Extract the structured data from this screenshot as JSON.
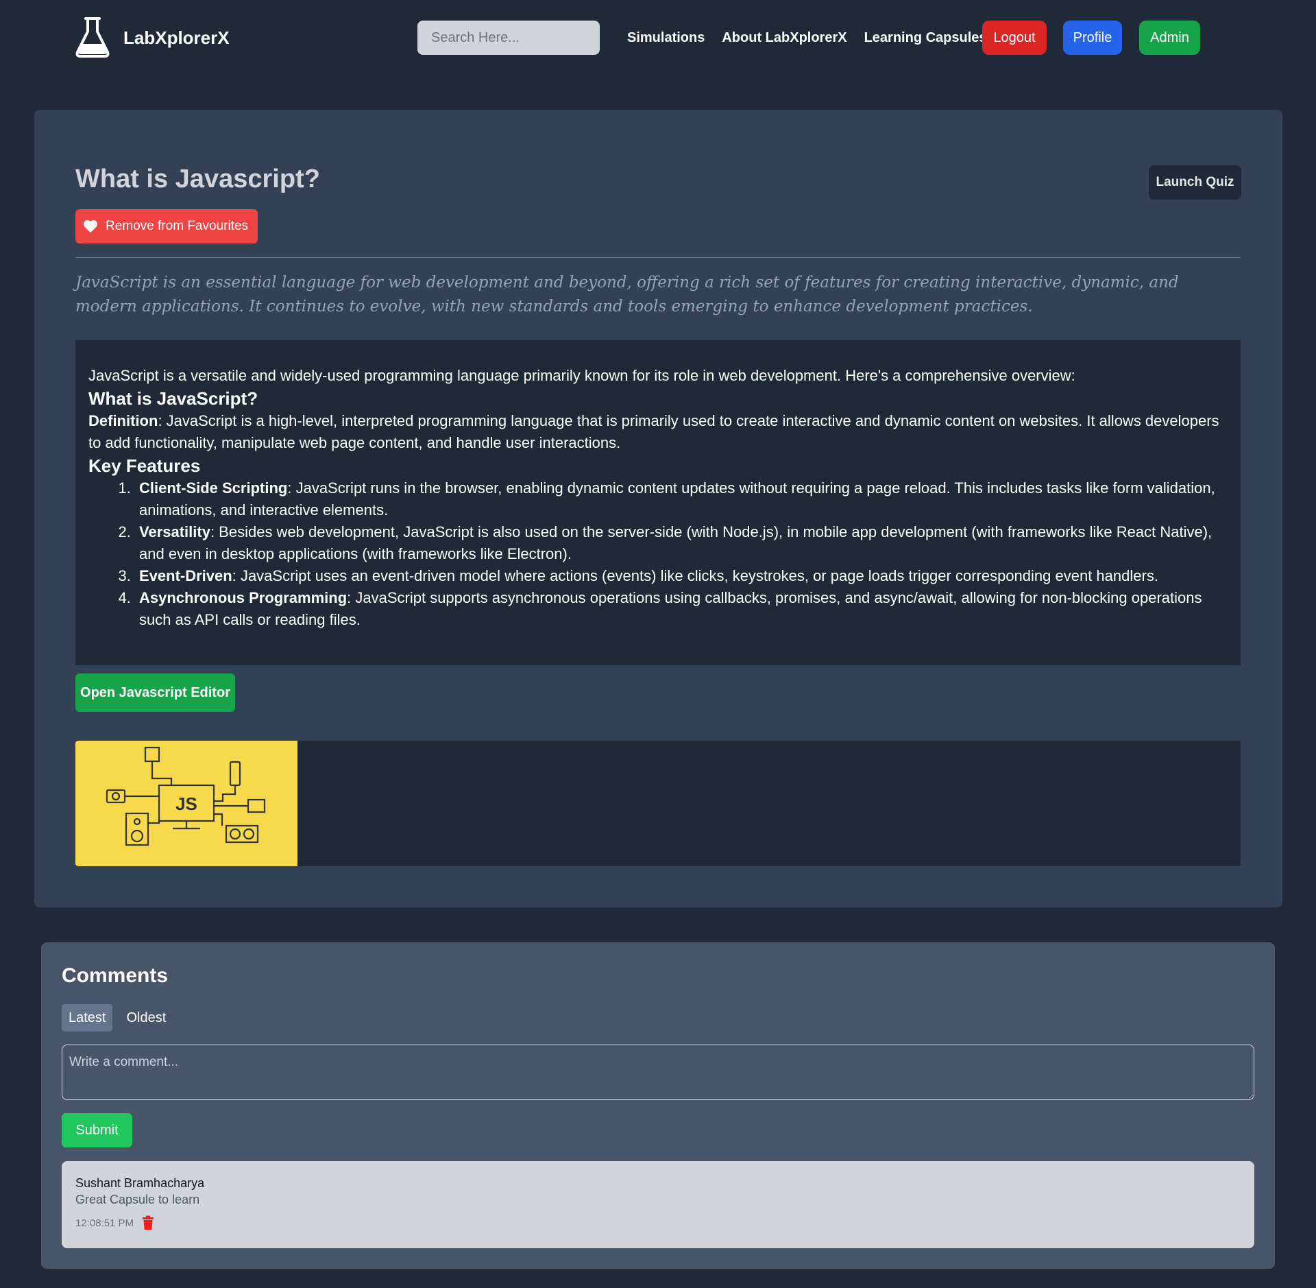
{
  "nav": {
    "brand": "LabXplorerX",
    "search_placeholder": "Search Here...",
    "links": [
      "Simulations",
      "About LabXplorerX",
      "Learning Capsules"
    ],
    "logout": "Logout",
    "profile": "Profile",
    "admin": "Admin"
  },
  "capsule": {
    "title": "What is Javascript?",
    "quiz_button": "Launch Quiz",
    "favourite_button": "Remove from Favourites",
    "summary": "JavaScript is an essential language for web development and beyond, offering a rich set of features for creating interactive, dynamic, and modern applications. It continues to evolve, with new standards and tools emerging to enhance development practices.",
    "body": {
      "intro": "JavaScript is a versatile and widely-used programming language primarily known for its role in web development. Here's a comprehensive overview:",
      "heading1": "What is JavaScript?",
      "definition_label": "Definition",
      "definition_text": ": JavaScript is a high-level, interpreted programming language that is primarily used to create interactive and dynamic content on websites. It allows developers to add functionality, manipulate web page content, and handle user interactions.",
      "heading2": "Key Features",
      "features": [
        {
          "label": "Client-Side Scripting",
          "text": ": JavaScript runs in the browser, enabling dynamic content updates without requiring a page reload. This includes tasks like form validation, animations, and interactive elements."
        },
        {
          "label": "Versatility",
          "text": ": Besides web development, JavaScript is also used on the server-side (with Node.js), in mobile app development (with frameworks like React Native), and even in desktop applications (with frameworks like Electron)."
        },
        {
          "label": "Event-Driven",
          "text": ": JavaScript uses an event-driven model where actions (events) like clicks, keystrokes, or page loads trigger corresponding event handlers."
        },
        {
          "label": "Asynchronous Programming",
          "text": ": JavaScript supports asynchronous operations using callbacks, promises, and async/await, allowing for non-blocking operations such as API calls or reading files."
        }
      ]
    },
    "editor_button": "Open Javascript Editor",
    "image_text": "JS"
  },
  "comments": {
    "title": "Comments",
    "tabs": [
      "Latest",
      "Oldest"
    ],
    "input_placeholder": "Write a comment...",
    "submit": "Submit",
    "items": [
      {
        "author": "Sushant Bramhacharya",
        "text": "Great Capsule to learn",
        "time": "12:08:51 PM"
      }
    ]
  },
  "colors": {
    "page_bg": "#1f2937",
    "card_bg": "#334155",
    "comments_bg": "#475569",
    "logout": "#dc2626",
    "profile": "#2563eb",
    "admin": "#16a34a",
    "favourite": "#ef4444",
    "image_bg": "#f7d94c"
  },
  "icons": [
    "flask-icon",
    "search-icon",
    "heart-icon",
    "trash-icon"
  ]
}
